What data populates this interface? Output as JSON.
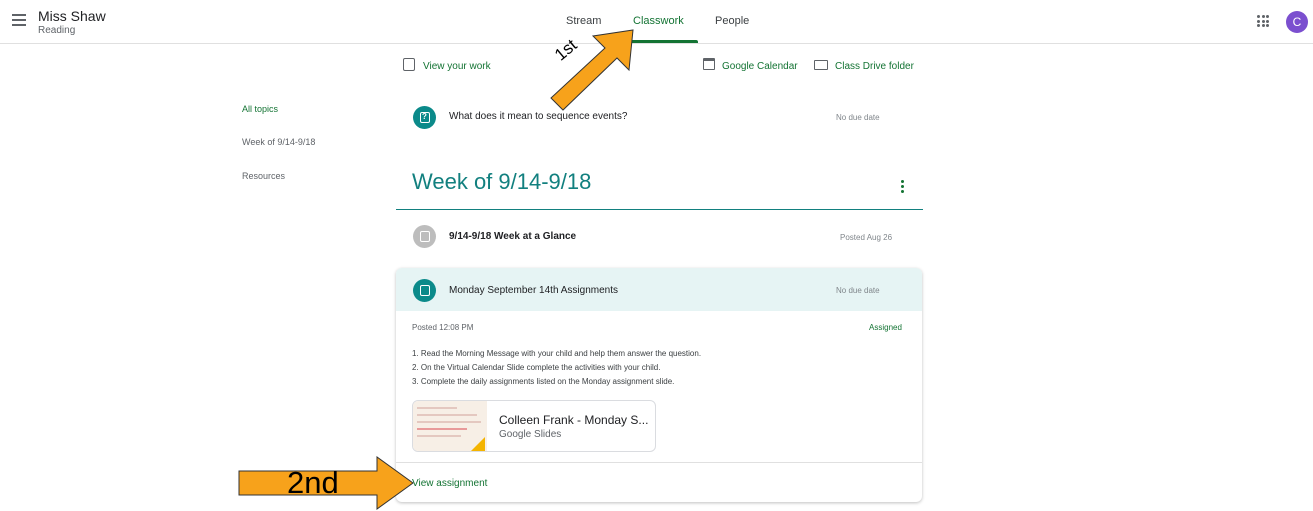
{
  "header": {
    "class_name": "Miss Shaw",
    "class_section": "Reading",
    "tabs": [
      {
        "label": "Stream"
      },
      {
        "label": "Classwork"
      },
      {
        "label": "People"
      }
    ],
    "avatar_initial": "C",
    "accent_color": "#137333"
  },
  "toolbar": {
    "view_work": "View your work",
    "google_calendar": "Google Calendar",
    "class_drive": "Class Drive folder"
  },
  "sidebar": {
    "topics": [
      {
        "label": "All topics"
      },
      {
        "label": "Week of 9/14-9/18"
      },
      {
        "label": "Resources"
      }
    ]
  },
  "question_item": {
    "icon": "question-icon",
    "title": "What does it mean to sequence events?",
    "due": "No due date"
  },
  "week_section": {
    "heading": "Week of 9/14-9/18",
    "material": {
      "icon": "material-icon",
      "title": "9/14-9/18 Week at a Glance",
      "date": "Posted Aug 26"
    },
    "assignment": {
      "icon": "assignment-icon",
      "title": "Monday September 14th Assignments",
      "due": "No due date",
      "posted": "Posted 12:08 PM",
      "status": "Assigned",
      "instructions": [
        "1. Read the Morning Message with your child and help them answer the question.",
        "2. On the Virtual Calendar Slide complete the activities with your child.",
        "3. Complete the daily assignments listed on the Monday assignment slide."
      ],
      "attachment": {
        "title": "Colleen Frank - Monday S...",
        "type": "Google Slides"
      },
      "view_link": "View assignment"
    }
  },
  "annotations": {
    "first": "1st",
    "second": "2nd",
    "arrow_color": "#f7a21b"
  }
}
